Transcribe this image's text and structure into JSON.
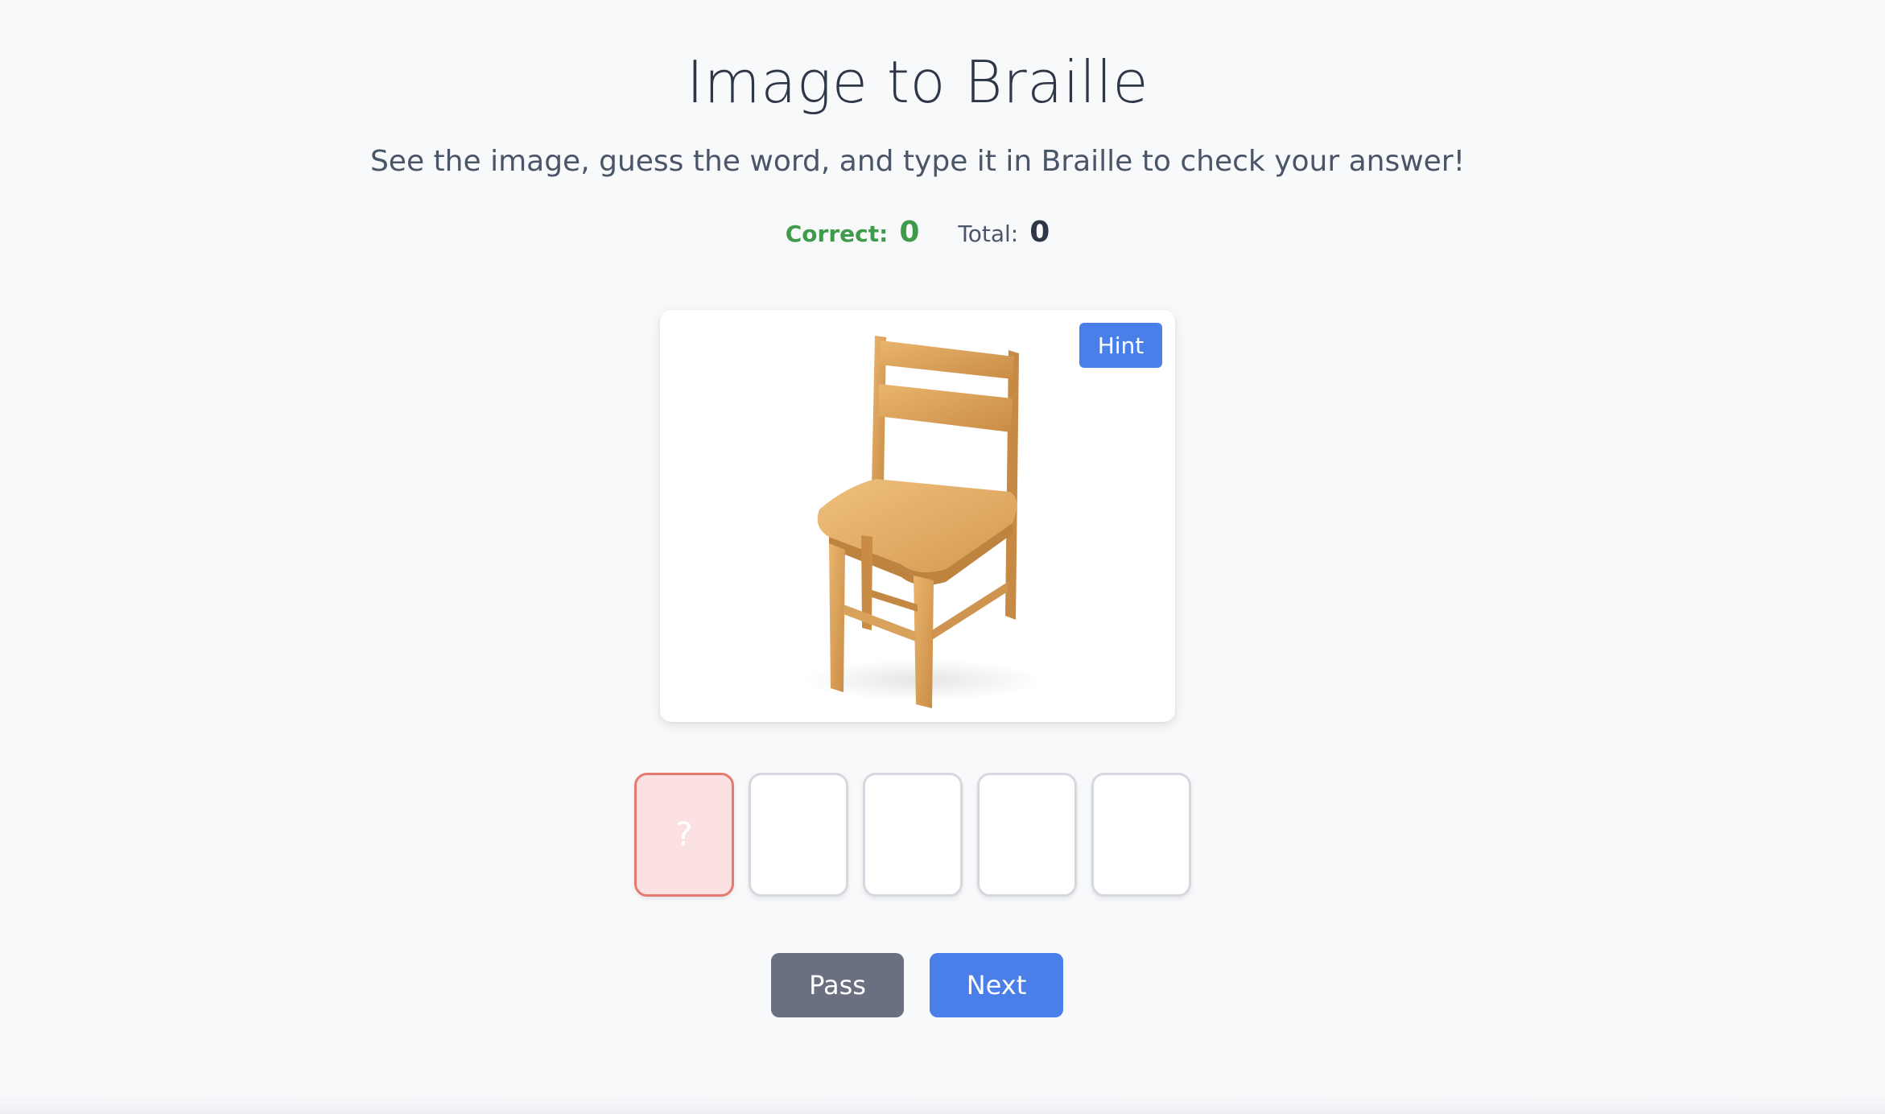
{
  "header": {
    "title": "Image to Braille",
    "subtitle": "See the image, guess the word, and type it in Braille to check your answer!"
  },
  "stats": {
    "correct_label": "Correct:",
    "correct_value": "0",
    "total_label": "Total:",
    "total_value": "0"
  },
  "image_card": {
    "image": "wooden-chair",
    "hint_label": "Hint"
  },
  "answer": {
    "boxes": [
      "?",
      "",
      "",
      "",
      ""
    ]
  },
  "actions": {
    "pass_label": "Pass",
    "next_label": "Next"
  },
  "colors": {
    "accent": "#4a7fea",
    "correct": "#3f9a4a",
    "pass_button": "#6b7080",
    "active_box_bg": "#fbe1e1",
    "active_box_border": "#e77a6e"
  }
}
